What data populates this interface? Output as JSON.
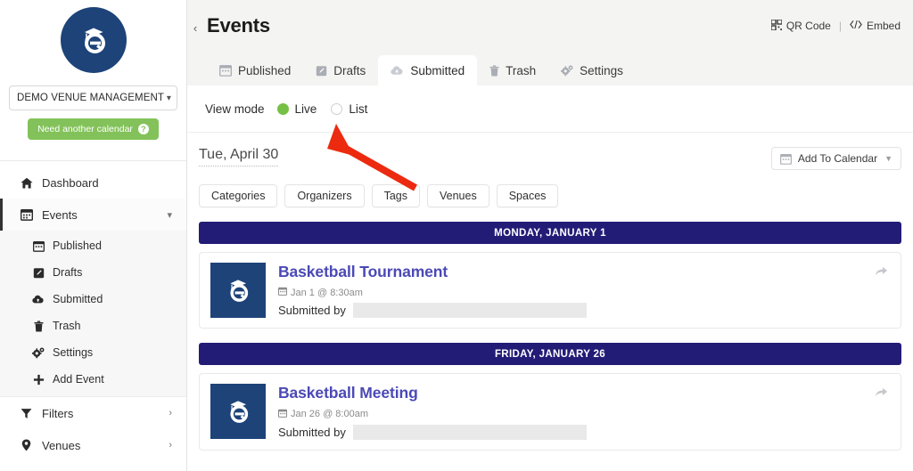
{
  "sidebar": {
    "logo_icon": "graduation-cap-e-logo",
    "venue_select": {
      "value": "DEMO VENUE MANAGEMENT",
      "caret_icon": "chevron-down-icon"
    },
    "need_calendar_button": {
      "label": "Need another calendar",
      "help_icon": "question-mark-icon",
      "color": "#83c25a"
    },
    "items": [
      {
        "label": "Dashboard",
        "icon": "home-icon",
        "chevron": ""
      },
      {
        "label": "Events",
        "icon": "calendar-icon",
        "chevron": "⌄"
      },
      {
        "label": "Filters",
        "icon": "funnel-icon",
        "chevron": "›"
      },
      {
        "label": "Venues",
        "icon": "map-pin-icon",
        "chevron": "›"
      }
    ],
    "subitems": [
      {
        "label": "Published",
        "icon": "calendar-icon"
      },
      {
        "label": "Drafts",
        "icon": "pencil-square-icon"
      },
      {
        "label": "Submitted",
        "icon": "cloud-upload-icon"
      },
      {
        "label": "Trash",
        "icon": "trash-icon"
      },
      {
        "label": "Settings",
        "icon": "gears-icon"
      },
      {
        "label": "Add Event",
        "icon": "plus-icon"
      }
    ]
  },
  "header": {
    "title": "Events",
    "collapse_icon": "chevron-left-icon",
    "actions": [
      {
        "label": "QR Code",
        "icon": "qr-code-icon"
      },
      {
        "label": "Embed",
        "icon": "code-brackets-icon"
      }
    ],
    "separator": "|"
  },
  "tabs": [
    {
      "label": "Published",
      "icon": "calendar-icon",
      "active": false
    },
    {
      "label": "Drafts",
      "icon": "pencil-square-icon",
      "active": false
    },
    {
      "label": "Submitted",
      "icon": "cloud-upload-icon",
      "active": true
    },
    {
      "label": "Trash",
      "icon": "trash-icon",
      "active": false
    },
    {
      "label": "Settings",
      "icon": "gears-icon",
      "active": false
    }
  ],
  "view_mode": {
    "label": "View mode",
    "options": [
      {
        "label": "Live",
        "selected": true
      },
      {
        "label": "List",
        "selected": false
      }
    ],
    "selected_color": "#76c043"
  },
  "board": {
    "current_date": "Tue, April 30",
    "add_to_calendar": {
      "label": "Add To Calendar",
      "icon": "calendar-icon",
      "caret_icon": "caret-down-icon"
    },
    "filter_chips": [
      "Categories",
      "Organizers",
      "Tags",
      "Venues",
      "Spaces"
    ],
    "groups": [
      {
        "day_header": "MONDAY, JANUARY 1",
        "events": [
          {
            "title": "Basketball Tournament",
            "time": "Jan 1 @ 8:30am",
            "time_icon": "calendar-icon",
            "submitted_by_label": "Submitted by",
            "submitted_by_value": "",
            "share_icon": "share-arrow-icon",
            "thumb_icon": "graduation-cap-e-logo"
          }
        ]
      },
      {
        "day_header": "FRIDAY, JANUARY 26",
        "events": [
          {
            "title": "Basketball Meeting",
            "time": "Jan 26 @ 8:00am",
            "time_icon": "calendar-icon",
            "submitted_by_label": "Submitted by",
            "submitted_by_value": "",
            "share_icon": "share-arrow-icon",
            "thumb_icon": "graduation-cap-e-logo"
          }
        ]
      }
    ]
  },
  "annotation": {
    "arrow_icon": "red-pointer-arrow",
    "color": "#ec2a10",
    "points_to": "Live"
  },
  "theme": {
    "brand_navy": "#1d4379",
    "day_header_navy": "#231c77",
    "event_title_purple": "#4b49b6",
    "green": "#76c043"
  }
}
